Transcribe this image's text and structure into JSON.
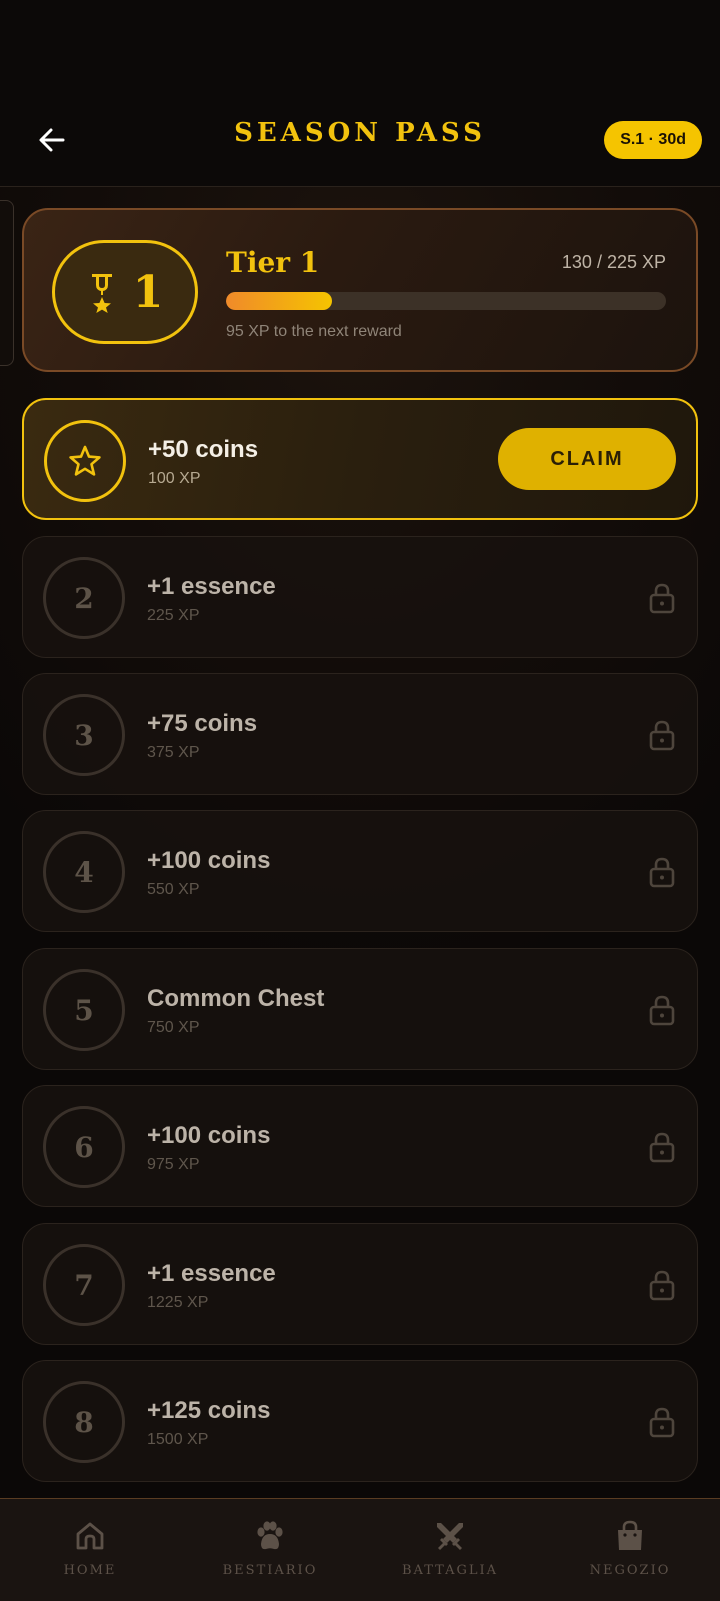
{
  "header": {
    "title": "SEASON PASS",
    "season_badge": "S.1 · 30d"
  },
  "tier_card": {
    "tier_number": "1",
    "tier_label": "Tier 1",
    "xp_text": "130 / 225 XP",
    "progress": 0.24,
    "next_reward_text": "95 XP to the next reward"
  },
  "rewards": [
    {
      "badge": "",
      "name": "+50 coins",
      "xp": "100 XP",
      "state": "claimable",
      "button": "CLAIM"
    },
    {
      "badge": "2",
      "name": "+1 essence",
      "xp": "225 XP",
      "state": "locked"
    },
    {
      "badge": "3",
      "name": "+75 coins",
      "xp": "375 XP",
      "state": "locked"
    },
    {
      "badge": "4",
      "name": "+100 coins",
      "xp": "550 XP",
      "state": "locked"
    },
    {
      "badge": "5",
      "name": "Common Chest",
      "xp": "750 XP",
      "state": "locked"
    },
    {
      "badge": "6",
      "name": "+100 coins",
      "xp": "975 XP",
      "state": "locked"
    },
    {
      "badge": "7",
      "name": "+1 essence",
      "xp": "1225 XP",
      "state": "locked"
    },
    {
      "badge": "8",
      "name": "+125 coins",
      "xp": "1500 XP",
      "state": "locked"
    }
  ],
  "nav": {
    "items": [
      {
        "label": "HOME",
        "icon": "home-icon"
      },
      {
        "label": "BESTIARIO",
        "icon": "paw-icon"
      },
      {
        "label": "BATTAGLIA",
        "icon": "crossed-swords-icon"
      },
      {
        "label": "NEGOZIO",
        "icon": "shopping-bag-icon"
      }
    ]
  },
  "colors": {
    "accent": "#f2c20e",
    "background": "#0d0908",
    "card_border": "#7a4a26"
  }
}
